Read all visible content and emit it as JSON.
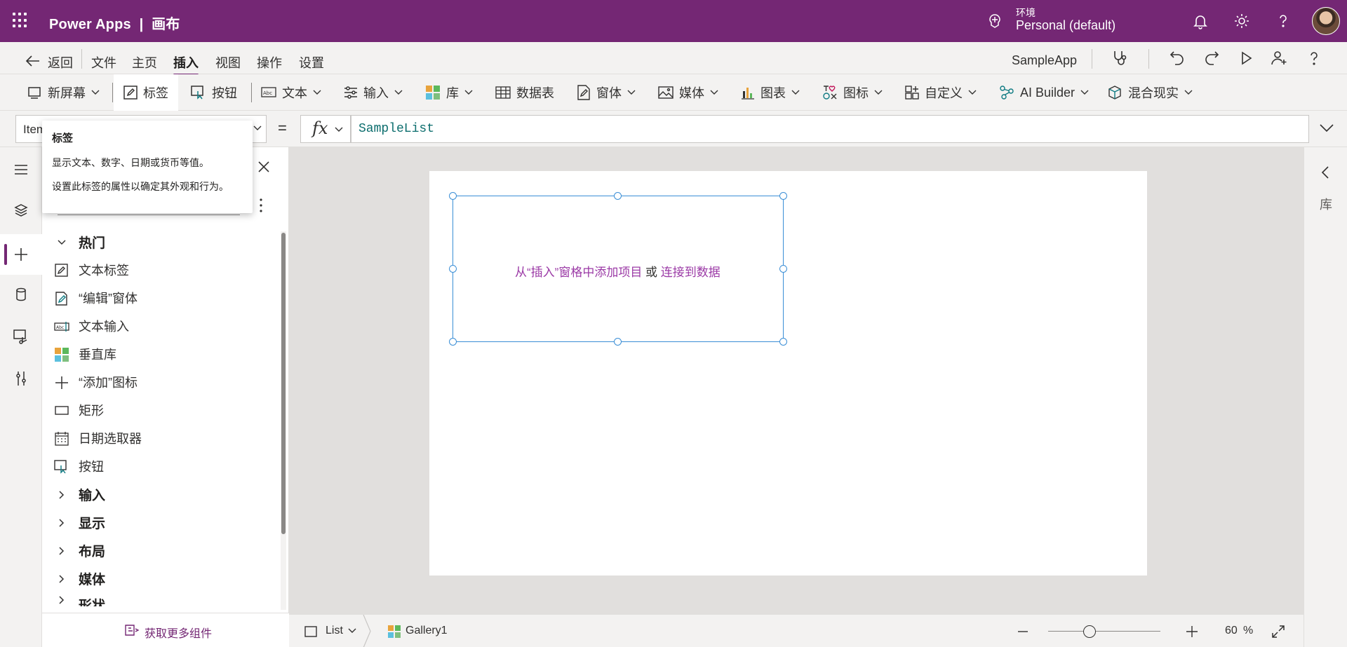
{
  "app": {
    "brand": "Power Apps",
    "brand_sep": "|",
    "mode": "画布",
    "env_label": "环境",
    "env_name": "Personal (default)"
  },
  "menu": {
    "back": "返回",
    "file": "文件",
    "home": "主页",
    "insert": "插入",
    "view": "视图",
    "action": "操作",
    "settings": "设置",
    "app_name": "SampleApp"
  },
  "toolbar": {
    "new_screen": "新屏幕",
    "label": "标签",
    "button": "按钮",
    "text": "文本",
    "input": "输入",
    "gallery": "库",
    "data_table": "数据表",
    "forms": "窗体",
    "media": "媒体",
    "charts": "图表",
    "icons": "图标",
    "custom": "自定义",
    "ai_builder": "AI Builder",
    "mixed_reality": "混合现实"
  },
  "formula": {
    "property": "Items",
    "equals": "=",
    "fx": "fx",
    "value": "SampleList"
  },
  "tooltip": {
    "title": "标签",
    "line1": "显示文本、数字、日期或货币等值。",
    "line2": "设置此标签的属性以确定其外观和行为。"
  },
  "insert_pane": {
    "items": [
      {
        "type": "group",
        "label": "热门",
        "icon": "chevron-down-icon"
      },
      {
        "type": "item",
        "label": "文本标签",
        "icon": "edit-label-icon"
      },
      {
        "type": "item",
        "label": "“编辑”窗体",
        "icon": "edit-form-icon"
      },
      {
        "type": "item",
        "label": "文本输入",
        "icon": "text-input-icon"
      },
      {
        "type": "item",
        "label": "垂直库",
        "icon": "gallery-icon"
      },
      {
        "type": "item",
        "label": "“添加”图标",
        "icon": "add-icon"
      },
      {
        "type": "item",
        "label": "矩形",
        "icon": "rectangle-icon"
      },
      {
        "type": "item",
        "label": "日期选取器",
        "icon": "calendar-icon"
      },
      {
        "type": "item",
        "label": "按钮",
        "icon": "button-icon"
      },
      {
        "type": "group",
        "label": "输入",
        "icon": "chevron-right-icon"
      },
      {
        "type": "group",
        "label": "显示",
        "icon": "chevron-right-icon"
      },
      {
        "type": "group",
        "label": "布局",
        "icon": "chevron-right-icon"
      },
      {
        "type": "group",
        "label": "媒体",
        "icon": "chevron-right-icon"
      },
      {
        "type": "group",
        "label": "形状",
        "icon": "chevron-right-icon"
      }
    ],
    "footer": "获取更多组件"
  },
  "canvas": {
    "placeholder_link1": "从“插入”窗格中添加项目",
    "placeholder_or": " 或 ",
    "placeholder_link2": "连接到数据"
  },
  "right_rail": {
    "label": "库"
  },
  "status": {
    "screen": "List",
    "control": "Gallery1",
    "zoom_value": "60",
    "zoom_unit": "%"
  },
  "colors": {
    "brand_purple": "#742774",
    "selection_blue": "#3a8ed6",
    "link_purple": "#9b3aa6"
  }
}
